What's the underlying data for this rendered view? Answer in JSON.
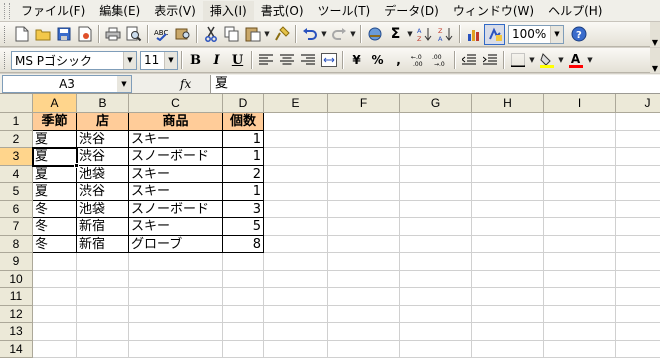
{
  "menu": [
    "ファイル(F)",
    "編集(E)",
    "表示(V)",
    "挿入(I)",
    "書式(O)",
    "ツール(T)",
    "データ(D)",
    "ウィンドウ(W)",
    "ヘルプ(H)"
  ],
  "toolbar": {
    "zoom": "100%",
    "font_name": "MS Pゴシック",
    "font_size": "11",
    "bold": "B",
    "italic": "I",
    "underline": "U",
    "currency": "¥",
    "percent": "%",
    "comma": ",",
    "autosum": "Σ",
    "font_color_letter": "A",
    "colors": {
      "fill": "#ffff00",
      "font": "#ff0000"
    }
  },
  "formula_bar": {
    "name_box": "A3",
    "fx": "fx",
    "content": "夏"
  },
  "columns": [
    "A",
    "B",
    "C",
    "D",
    "E",
    "F",
    "G",
    "H",
    "I",
    "J"
  ],
  "rows": [
    "1",
    "2",
    "3",
    "4",
    "5",
    "6",
    "7",
    "8",
    "9",
    "10",
    "11",
    "12",
    "13",
    "14"
  ],
  "table": {
    "headers": [
      "季節",
      "店",
      "商品",
      "個数"
    ],
    "rows": [
      [
        "夏",
        "渋谷",
        "スキー",
        "1"
      ],
      [
        "夏",
        "渋谷",
        "スノーボード",
        "1"
      ],
      [
        "夏",
        "池袋",
        "スキー",
        "2"
      ],
      [
        "夏",
        "渋谷",
        "スキー",
        "1"
      ],
      [
        "冬",
        "池袋",
        "スノーボード",
        "3"
      ],
      [
        "冬",
        "新宿",
        "スキー",
        "5"
      ],
      [
        "冬",
        "新宿",
        "グローブ",
        "8"
      ]
    ]
  },
  "selected_cell": "A3"
}
